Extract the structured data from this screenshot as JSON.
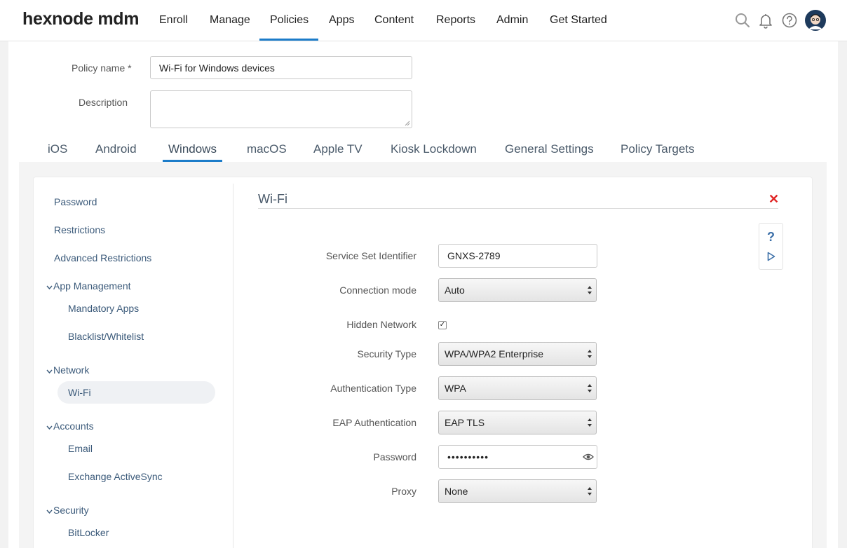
{
  "app": {
    "logo": "hexnode mdm",
    "nav": [
      "Enroll",
      "Manage",
      "Policies",
      "Apps",
      "Content",
      "Reports",
      "Admin",
      "Get Started"
    ],
    "active_nav": "Policies"
  },
  "policy": {
    "name_label": "Policy name *",
    "name_value": "Wi-Fi for Windows devices",
    "description_label": "Description",
    "description_value": ""
  },
  "os_tabs": [
    "iOS",
    "Android",
    "Windows",
    "macOS",
    "Apple TV",
    "Kiosk Lockdown",
    "General Settings",
    "Policy Targets"
  ],
  "active_os_tab": "Windows",
  "sidebar": {
    "items": [
      {
        "label": "Password"
      },
      {
        "label": "Restrictions"
      },
      {
        "label": "Advanced Restrictions"
      }
    ],
    "groups": [
      {
        "label": "App Management",
        "children": [
          "Mandatory Apps",
          "Blacklist/Whitelist"
        ]
      },
      {
        "label": "Network",
        "children": [
          "Wi-Fi"
        ]
      },
      {
        "label": "Accounts",
        "children": [
          "Email",
          "Exchange ActiveSync"
        ]
      },
      {
        "label": "Security",
        "children": [
          "BitLocker"
        ]
      }
    ],
    "active": "Wi-Fi"
  },
  "section": {
    "title": "Wi-Fi",
    "help_label": "?",
    "fields": {
      "ssid": {
        "label": "Service Set Identifier",
        "value": "GNXS-2789"
      },
      "connection_mode": {
        "label": "Connection mode",
        "value": "Auto"
      },
      "hidden_network": {
        "label": "Hidden Network",
        "checked": true,
        "mark": "✓"
      },
      "security_type": {
        "label": "Security Type",
        "value": "WPA/WPA2 Enterprise"
      },
      "auth_type": {
        "label": "Authentication Type",
        "value": "WPA"
      },
      "eap_auth": {
        "label": "EAP Authentication",
        "value": "EAP TLS"
      },
      "password": {
        "label": "Password",
        "value": "••••••••••"
      },
      "proxy": {
        "label": "Proxy",
        "value": "None"
      }
    }
  },
  "colors": {
    "accent": "#1c7cc9",
    "link": "#3b5a7a",
    "close": "#e02424"
  }
}
